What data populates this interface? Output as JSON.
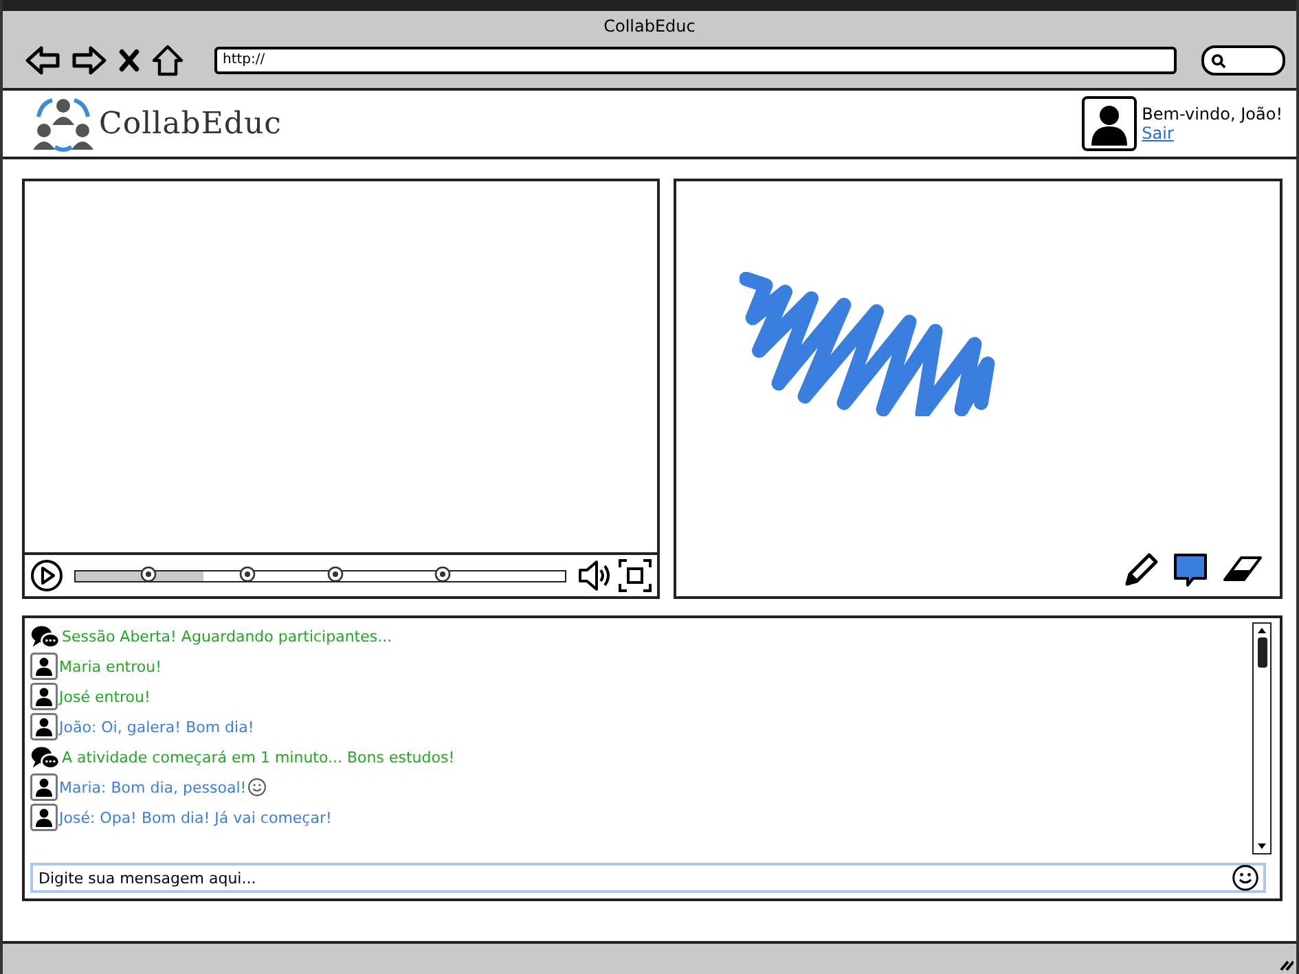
{
  "window": {
    "title": "CollabEduc"
  },
  "address_bar": {
    "value": "http://"
  },
  "header": {
    "logo_text": "CollabEduc",
    "greeting": "Bem-vindo, João!",
    "logout_link": "Sair"
  },
  "video_player": {
    "progress": {
      "level": 0.26
    }
  },
  "chat": {
    "messages": [
      {
        "kind": "system",
        "text": "Sessão Aberta! Aguardando participantes...",
        "color": "#22a722",
        "emoji": false
      },
      {
        "kind": "user",
        "text": "Maria entrou!",
        "color": "#22a722",
        "emoji": false
      },
      {
        "kind": "user",
        "text": "José entrou!",
        "color": "#22a722",
        "emoji": false
      },
      {
        "kind": "user",
        "text": "João: Oi, galera! Bom dia!",
        "color": "#3a7ee0",
        "emoji": false
      },
      {
        "kind": "system",
        "text": "A atividade começará em 1 minuto... Bons estudos!",
        "color": "#22a722",
        "emoji": false
      },
      {
        "kind": "user",
        "text": "Maria: Bom dia, pessoal!",
        "color": "#3a7ee0",
        "emoji": true
      },
      {
        "kind": "user",
        "text": "José: Opa! Bom dia! Já vai começar!",
        "color": "#3a7ee0",
        "emoji": false
      }
    ],
    "input": {
      "placeholder": "Digite sua mensagem aqui..."
    }
  }
}
